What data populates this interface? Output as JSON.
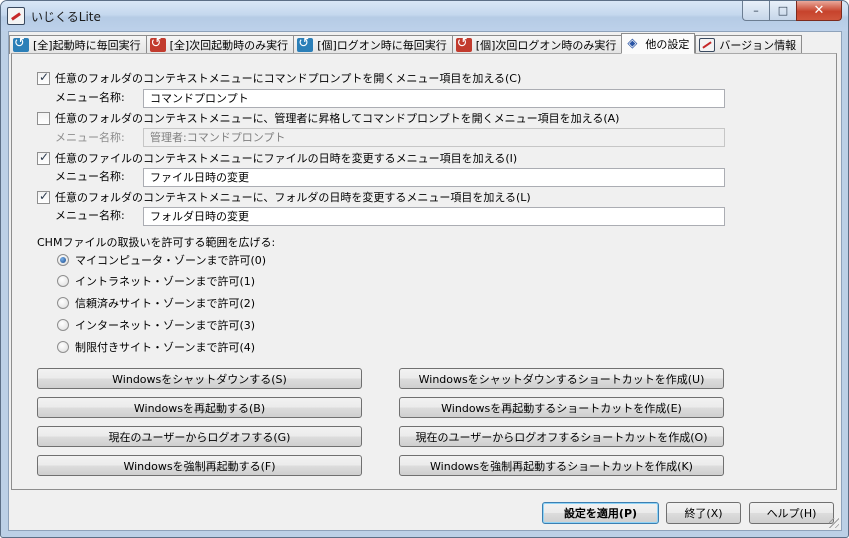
{
  "window": {
    "title": "いじくるLite",
    "controls": {
      "minimize": "–",
      "maximize": "□",
      "close": "✕"
    }
  },
  "tabs": [
    {
      "label": "[全]起動時に毎回実行",
      "icon": "recurring-run-icon",
      "active": false
    },
    {
      "label": "[全]次回起動時のみ実行",
      "icon": "run-once-icon",
      "active": false
    },
    {
      "label": "[個]ログオン時に毎回実行",
      "icon": "recurring-run-icon",
      "active": false
    },
    {
      "label": "[個]次回ログオン時のみ実行",
      "icon": "run-once-icon",
      "active": false
    },
    {
      "label": "他の設定",
      "icon": "settings-icon",
      "active": true
    },
    {
      "label": "バージョン情報",
      "icon": "app-icon",
      "active": false
    }
  ],
  "context_menus": [
    {
      "checked": true,
      "label": "任意のフォルダのコンテキストメニューにコマンドプロンプトを開くメニュー項目を加える(C)",
      "name_label": "メニュー名称:",
      "value": "コマンドプロンプト",
      "enabled": true
    },
    {
      "checked": false,
      "label": "任意のフォルダのコンテキストメニューに、管理者に昇格してコマンドプロンプトを開くメニュー項目を加える(A)",
      "name_label": "メニュー名称:",
      "value": "管理者:コマンドプロンプト",
      "enabled": false
    },
    {
      "checked": true,
      "label": "任意のファイルのコンテキストメニューにファイルの日時を変更するメニュー項目を加える(I)",
      "name_label": "メニュー名称:",
      "value": "ファイル日時の変更",
      "enabled": true
    },
    {
      "checked": true,
      "label": "任意のフォルダのコンテキストメニューに、フォルダの日時を変更するメニュー項目を加える(L)",
      "name_label": "メニュー名称:",
      "value": "フォルダ日時の変更",
      "enabled": true
    }
  ],
  "chm": {
    "heading": "CHMファイルの取扱いを許可する範囲を広げる:",
    "options": [
      {
        "label": "マイコンピュータ・ゾーンまで許可(0)",
        "selected": true
      },
      {
        "label": "イントラネット・ゾーンまで許可(1)",
        "selected": false
      },
      {
        "label": "信頼済みサイト・ゾーンまで許可(2)",
        "selected": false
      },
      {
        "label": "インターネット・ゾーンまで許可(3)",
        "selected": false
      },
      {
        "label": "制限付きサイト・ゾーンまで許可(4)",
        "selected": false
      }
    ]
  },
  "actions": {
    "shutdown": "Windowsをシャットダウンする(S)",
    "shutdown_shortcut": "Windowsをシャットダウンするショートカットを作成(U)",
    "restart": "Windowsを再起動する(B)",
    "restart_shortcut": "Windowsを再起動するショートカットを作成(E)",
    "logoff": "現在のユーザーからログオフする(G)",
    "logoff_shortcut": "現在のユーザーからログオフするショートカットを作成(O)",
    "force_restart": "Windowsを強制再起動する(F)",
    "force_restart_shortcut": "Windowsを強制再起動するショートカットを作成(K)"
  },
  "footer": {
    "apply": "設定を適用(P)",
    "exit": "終了(X)",
    "help": "ヘルプ(H)"
  }
}
